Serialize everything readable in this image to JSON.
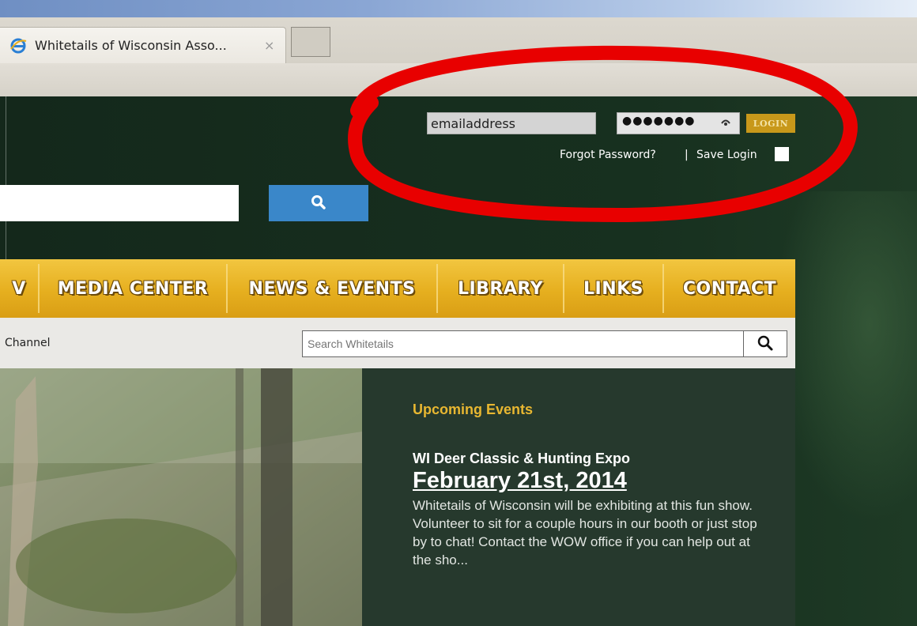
{
  "browser": {
    "tab_title": "Whitetails of Wisconsin Asso...",
    "tab_close": "×"
  },
  "login": {
    "email_value": "emailaddress",
    "password_mask": "●●●●●●●",
    "login_label": "LOGIN",
    "forgot_label": "Forgot Password?",
    "separator": "|",
    "save_login_label": "Save Login"
  },
  "nav": {
    "items": [
      "V",
      "MEDIA CENTER",
      "NEWS & EVENTS",
      "LIBRARY",
      "LINKS",
      "CONTACT"
    ]
  },
  "subbar": {
    "channel_label": "Channel",
    "search_placeholder": "Search Whitetails"
  },
  "events": {
    "heading": "Upcoming Events",
    "title": "WI Deer Classic & Hunting Expo",
    "date": "February 21st, 2014",
    "description": "Whitetails of Wisconsin will be exhibiting at this fun show.  Volunteer to sit for a couple hours in our booth or just stop by to chat! Contact the WOW office if you can help out at the sho..."
  },
  "icons": {
    "favicon": "ie-icon",
    "search": "search-icon",
    "reveal": "eye-icon"
  },
  "colors": {
    "nav_gold": "#e6af1f",
    "search_blue": "#3a87c9",
    "events_heading": "#e8b731",
    "annotation_red": "#e80000",
    "page_green": "#17301f"
  }
}
